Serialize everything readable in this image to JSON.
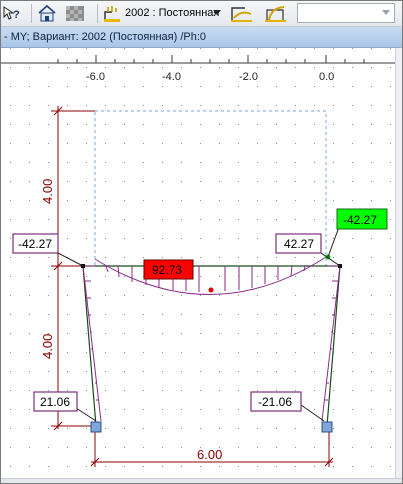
{
  "toolbar": {
    "help_glyph": "?",
    "variant_label": "2002 : Постоянная"
  },
  "window": {
    "title": "- MY; Вариант: 2002 (Постоянная) /Ph:0"
  },
  "ruler": {
    "ticks": [
      "-6.0",
      "-4.0",
      "-2.0",
      "0.0"
    ]
  },
  "dimensions": {
    "upper_height": "4.00",
    "lower_height": "4.00",
    "span": "6.00"
  },
  "moments": {
    "left_top": "-42.27",
    "right_top_inner": "42.27",
    "right_top_outer": "-42.27",
    "midspan": "92.73",
    "left_bottom": "21.06",
    "right_bottom": "-21.06"
  },
  "colors": {
    "diagram": "#8b2a8b",
    "dimension": "#8b0000",
    "member": "#1a4a1a",
    "highlight_red": "#ff0000",
    "highlight_green": "#00ff00",
    "label_border": "#7b2f7b"
  }
}
